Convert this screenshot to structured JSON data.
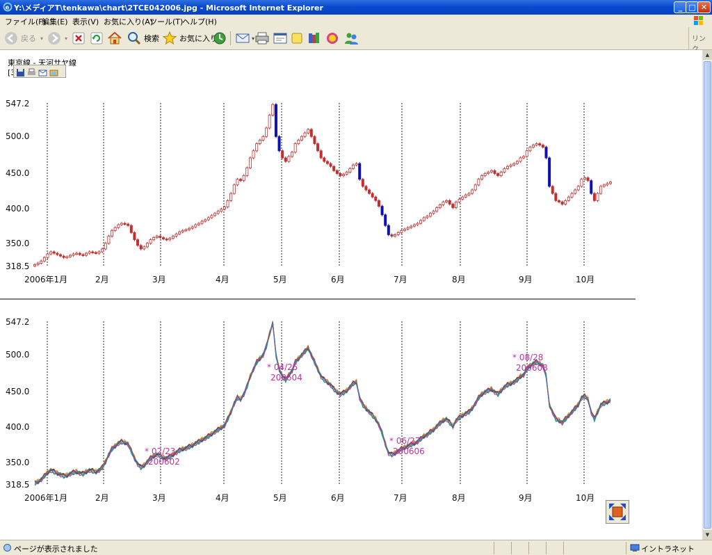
{
  "window": {
    "title": "Y:\\メディアT\\tenkawa\\chart\\2TCE042006.jpg - Microsoft Internet Explorer",
    "minimize": "_",
    "maximize": "□",
    "close": "✕"
  },
  "menu": {
    "file": "ファイル(F)",
    "edit": "編集(E)",
    "view": "表示(V)",
    "favorites": "お気に入り(A)",
    "tools": "ツール(T)",
    "help": "ヘルプ(H)"
  },
  "toolbar": {
    "back": "戻る",
    "search": "検索",
    "favorites": "お気に入り",
    "links": "リンク"
  },
  "page": {
    "header": "東京線 - 天河サヤ線",
    "header_sub": "[3"
  },
  "status": {
    "text": "ページが表示されました",
    "zone": "イントラネット"
  },
  "chart_data": [
    {
      "type": "candlestick",
      "ylim": [
        318.5,
        547.2
      ],
      "y_ticks": [
        "547.2",
        "500.0",
        "450.0",
        "400.0",
        "350.0",
        "318.5"
      ],
      "x_ticks": [
        "2006年1月",
        "2月",
        "3月",
        "4月",
        "5月",
        "6月",
        "7月",
        "8月",
        "9月",
        "10月"
      ],
      "grid": true,
      "values": [
        320,
        322,
        325,
        330,
        335,
        338,
        336,
        334,
        332,
        330,
        331,
        333,
        335,
        336,
        334,
        333,
        336,
        338,
        337,
        336,
        338,
        342,
        350,
        360,
        368,
        372,
        376,
        378,
        377,
        375,
        365,
        355,
        347,
        342,
        345,
        350,
        355,
        358,
        360,
        358,
        356,
        355,
        357,
        360,
        363,
        366,
        368,
        369,
        371,
        373,
        376,
        378,
        381,
        383,
        386,
        389,
        392,
        395,
        398,
        401,
        410,
        420,
        432,
        440,
        438,
        445,
        456,
        470,
        480,
        490,
        495,
        500,
        512,
        530,
        545,
        500,
        480,
        470,
        465,
        472,
        478,
        490,
        495,
        500,
        505,
        510,
        500,
        490,
        480,
        470,
        465,
        462,
        458,
        452,
        448,
        445,
        447,
        450,
        455,
        460,
        462,
        440,
        430,
        425,
        420,
        415,
        410,
        402,
        390,
        375,
        362,
        360,
        362,
        365,
        368,
        370,
        372,
        374,
        376,
        378,
        382,
        386,
        388,
        392,
        395,
        400,
        404,
        408,
        410,
        405,
        400,
        408,
        412,
        415,
        418,
        420,
        425,
        432,
        440,
        445,
        448,
        450,
        452,
        448,
        445,
        450,
        455,
        458,
        460,
        462,
        465,
        470,
        472,
        480,
        485,
        488,
        490,
        488,
        485,
        470,
        430,
        420,
        410,
        408,
        405,
        410,
        415,
        420,
        425,
        430,
        440,
        442,
        438,
        420,
        410,
        420,
        430,
        432,
        434,
        436
      ]
    },
    {
      "type": "line",
      "ylim": [
        318.5,
        547.2
      ],
      "y_ticks": [
        "547.2",
        "500.0",
        "450.0",
        "400.0",
        "350.0",
        "318.5"
      ],
      "x_ticks": [
        "2006年1月",
        "2月",
        "3月",
        "4月",
        "5月",
        "6月",
        "7月",
        "8月",
        "9月",
        "10月"
      ],
      "grid": true,
      "colors": [
        "#2a8a2a",
        "#1a1a70",
        "#d09010",
        "#9a3a9a",
        "#20a0a0",
        "#b04020",
        "#5070c0"
      ],
      "values": [
        320,
        322,
        325,
        330,
        335,
        338,
        336,
        334,
        332,
        330,
        331,
        333,
        335,
        336,
        334,
        333,
        336,
        338,
        337,
        336,
        338,
        342,
        350,
        360,
        368,
        372,
        376,
        378,
        377,
        375,
        365,
        355,
        347,
        342,
        345,
        350,
        355,
        358,
        360,
        358,
        356,
        355,
        357,
        360,
        363,
        366,
        368,
        369,
        371,
        373,
        376,
        378,
        381,
        383,
        386,
        389,
        392,
        395,
        398,
        401,
        410,
        420,
        432,
        440,
        438,
        445,
        456,
        470,
        480,
        490,
        495,
        500,
        512,
        530,
        545,
        500,
        480,
        470,
        465,
        472,
        478,
        490,
        495,
        500,
        505,
        510,
        500,
        490,
        480,
        470,
        465,
        462,
        458,
        452,
        448,
        445,
        447,
        450,
        455,
        460,
        462,
        440,
        430,
        425,
        420,
        415,
        410,
        402,
        390,
        375,
        362,
        360,
        362,
        365,
        368,
        370,
        372,
        374,
        376,
        378,
        382,
        386,
        388,
        392,
        395,
        400,
        404,
        408,
        410,
        405,
        400,
        408,
        412,
        415,
        418,
        420,
        425,
        432,
        440,
        445,
        448,
        450,
        452,
        448,
        445,
        450,
        455,
        458,
        460,
        462,
        465,
        470,
        472,
        480,
        485,
        488,
        490,
        488,
        485,
        470,
        430,
        420,
        410,
        408,
        405,
        410,
        415,
        420,
        425,
        430,
        440,
        442,
        438,
        420,
        410,
        420,
        430,
        432,
        434,
        436
      ],
      "annotations": [
        {
          "date": "02/23",
          "code": "200602"
        },
        {
          "date": "04/25",
          "code": "200604"
        },
        {
          "date": "06/27",
          "code": "200606"
        },
        {
          "date": "08/28",
          "code": "200608"
        }
      ]
    }
  ]
}
